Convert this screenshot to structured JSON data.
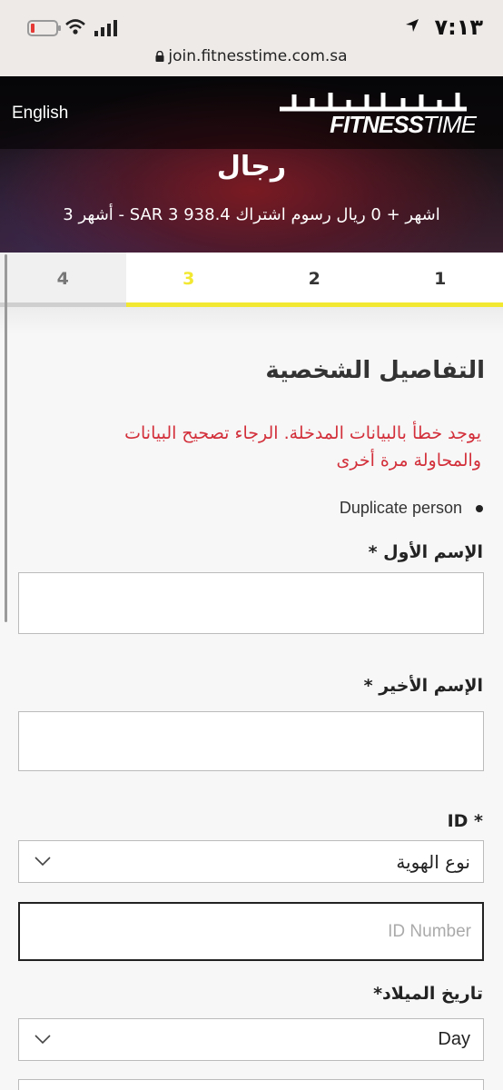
{
  "status_bar": {
    "time": "٧:١٣",
    "url": "join.fitnesstime.com.sa"
  },
  "header": {
    "language_link": "English",
    "logo_arabic": "وقت اللياقة",
    "logo_fitness": "FITNESS",
    "logo_time": "TIME",
    "plan_title": "رجال",
    "plan_price": "3 أشهر - SAR 3 938.4 اشهر + 0 ريال رسوم اشتراك"
  },
  "steps": [
    {
      "label": "1",
      "state": "done"
    },
    {
      "label": "2",
      "state": "done"
    },
    {
      "label": "3",
      "state": "active"
    },
    {
      "label": "4",
      "state": "upcoming"
    }
  ],
  "form": {
    "section_title": "التفاصيل الشخصية",
    "error_message": "يوجد خطأ بالبيانات المدخلة. الرجاء تصحيح البيانات والمحاولة مرة أخرى",
    "errors": [
      "Duplicate person"
    ],
    "first_name_label": "الإسم الأول *",
    "first_name_value": "",
    "last_name_label": "الإسم الأخير *",
    "last_name_value": "",
    "id_label": "* ID",
    "id_type_value": "نوع الهوية",
    "id_number_placeholder": "ID Number",
    "dob_label": "تاريخ الميلاد*",
    "dob_day_value": "Day"
  },
  "colors": {
    "accent_yellow": "#f2e832",
    "error_red": "#d22f3a"
  }
}
